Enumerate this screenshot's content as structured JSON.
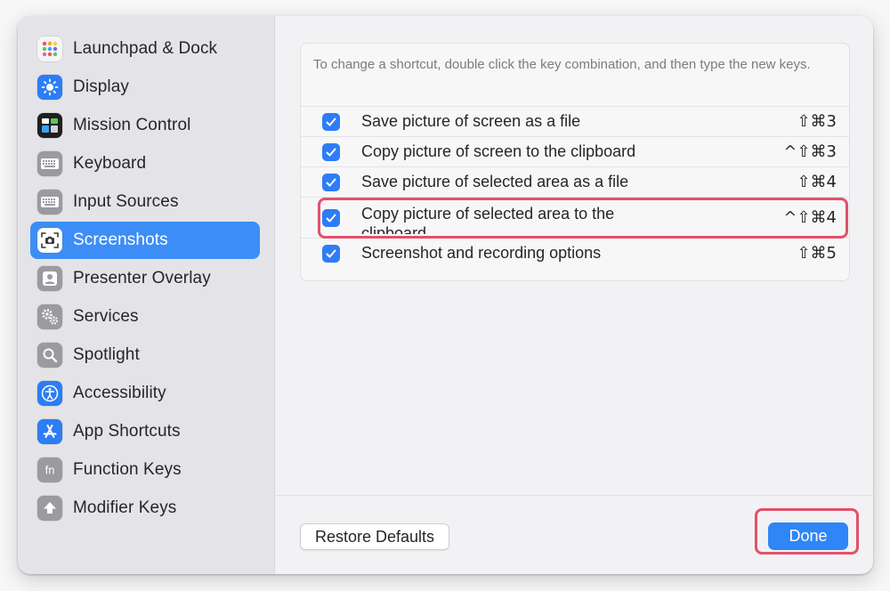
{
  "sidebar": {
    "items": [
      {
        "label": "Launchpad & Dock",
        "icon": "launchpad-icon",
        "color": "#f5f5f5"
      },
      {
        "label": "Display",
        "icon": "display-icon",
        "color": "#2c7df6"
      },
      {
        "label": "Mission Control",
        "icon": "mission-control-icon",
        "color": "#1f1f1f"
      },
      {
        "label": "Keyboard",
        "icon": "keyboard-icon",
        "color": "#9a9a9f"
      },
      {
        "label": "Input Sources",
        "icon": "input-sources-icon",
        "color": "#9a9a9f"
      },
      {
        "label": "Screenshots",
        "icon": "screenshot-icon",
        "color": "#5a5a5e"
      },
      {
        "label": "Presenter Overlay",
        "icon": "presenter-overlay-icon",
        "color": "#9a9a9f"
      },
      {
        "label": "Services",
        "icon": "gears-icon",
        "color": "#9a9a9f"
      },
      {
        "label": "Spotlight",
        "icon": "magnifier-icon",
        "color": "#9a9a9f"
      },
      {
        "label": "Accessibility",
        "icon": "accessibility-icon",
        "color": "#2c7df6"
      },
      {
        "label": "App Shortcuts",
        "icon": "app-store-icon",
        "color": "#2c7df6"
      },
      {
        "label": "Function Keys",
        "icon": "fn-icon",
        "color": "#9a9a9f"
      },
      {
        "label": "Modifier Keys",
        "icon": "modifier-up-arrow-icon",
        "color": "#9a9a9f"
      }
    ],
    "selected_index": 5,
    "selected_color": "#3c8ef6"
  },
  "shortcuts": {
    "hint": "To change a shortcut, double click the key combination, and then type the new keys.",
    "rows": [
      {
        "label": "Save picture of screen as a file",
        "keys": "⇧⌘3",
        "checked": true
      },
      {
        "label": "Copy picture of screen to the clipboard",
        "keys": "^⇧⌘3",
        "checked": true
      },
      {
        "label": "Save picture of selected area as a file",
        "keys": "⇧⌘4",
        "checked": true
      },
      {
        "label": "Copy picture of selected area to the clipboard",
        "keys": "^⇧⌘4",
        "checked": true
      },
      {
        "label": "Screenshot and recording options",
        "keys": "⇧⌘5",
        "checked": true
      }
    ]
  },
  "footer": {
    "restore_label": "Restore Defaults",
    "done_label": "Done"
  },
  "colors": {
    "accent": "#2f86f7",
    "highlight": "#e3506a"
  }
}
